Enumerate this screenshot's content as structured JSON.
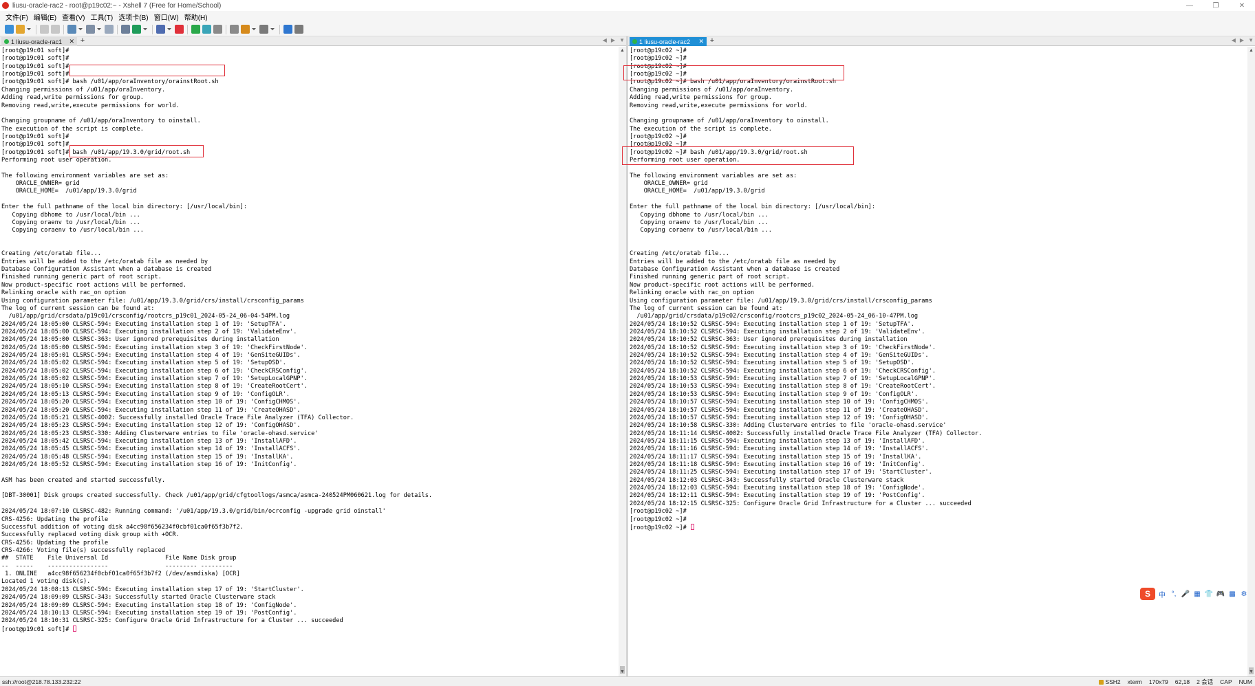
{
  "window": {
    "title": "liusu-oracle-rac2 - root@p19c02:~ - Xshell 7 (Free for Home/School)",
    "controls": [
      "—",
      "❐",
      "✕"
    ]
  },
  "menu": [
    "文件(F)",
    "编辑(E)",
    "查看(V)",
    "工具(T)",
    "选项卡(B)",
    "窗口(W)",
    "帮助(H)"
  ],
  "toolbar": {
    "buttons": [
      {
        "icon": "new-session-icon",
        "color": "#3b8fd8"
      },
      {
        "icon": "open-folder-icon",
        "color": "#e3a630"
      },
      {
        "icon": "reconnect-icon",
        "color": "#c7c7c7"
      },
      {
        "icon": "disconnect-icon",
        "color": "#c7c7c7"
      },
      {
        "icon": "properties-icon",
        "color": "#5a8ab8"
      },
      {
        "icon": "copy-icon",
        "color": "#7f8fa5"
      },
      {
        "icon": "paste-icon",
        "color": "#9aa9bd"
      },
      {
        "icon": "find-icon",
        "color": "#6c7f99"
      },
      {
        "icon": "globe-icon",
        "color": "#1f9c5a"
      },
      {
        "icon": "font-icon",
        "color": "#4f6cb0"
      },
      {
        "icon": "xftp-icon",
        "color": "#e0303a"
      },
      {
        "icon": "xmanager-icon",
        "color": "#2aa84a"
      },
      {
        "icon": "fullscreen-icon",
        "color": "#3aa5b8"
      },
      {
        "icon": "lock-icon",
        "color": "#8a8a8a"
      },
      {
        "icon": "keyboard-icon",
        "color": "#8a8a8a"
      },
      {
        "icon": "script-icon",
        "color": "#d68a1c"
      },
      {
        "icon": "layout-icon",
        "color": "#7a7a7a"
      },
      {
        "icon": "help-icon",
        "color": "#2f77d0"
      },
      {
        "icon": "chat-icon",
        "color": "#7a7a7a"
      }
    ]
  },
  "left_pane": {
    "tab_label": "1 liusu-oracle-rac1",
    "lines": [
      "[root@p19c01 soft]#",
      "[root@p19c01 soft]#",
      "[root@p19c01 soft]#",
      "[root@p19c01 soft]#",
      "[root@p19c01 soft]# bash /u01/app/oraInventory/orainstRoot.sh",
      "Changing permissions of /u01/app/oraInventory.",
      "Adding read,write permissions for group.",
      "Removing read,write,execute permissions for world.",
      "",
      "Changing groupname of /u01/app/oraInventory to oinstall.",
      "The execution of the script is complete.",
      "[root@p19c01 soft]#",
      "[root@p19c01 soft]#",
      "[root@p19c01 soft]# bash /u01/app/19.3.0/grid/root.sh",
      "Performing root user operation.",
      "",
      "The following environment variables are set as:",
      "    ORACLE_OWNER= grid",
      "    ORACLE_HOME=  /u01/app/19.3.0/grid",
      "",
      "Enter the full pathname of the local bin directory: [/usr/local/bin]:",
      "   Copying dbhome to /usr/local/bin ...",
      "   Copying oraenv to /usr/local/bin ...",
      "   Copying coraenv to /usr/local/bin ...",
      "",
      "",
      "Creating /etc/oratab file...",
      "Entries will be added to the /etc/oratab file as needed by",
      "Database Configuration Assistant when a database is created",
      "Finished running generic part of root script.",
      "Now product-specific root actions will be performed.",
      "Relinking oracle with rac_on option",
      "Using configuration parameter file: /u01/app/19.3.0/grid/crs/install/crsconfig_params",
      "The log of current session can be found at:",
      "  /u01/app/grid/crsdata/p19c01/crsconfig/rootcrs_p19c01_2024-05-24_06-04-54PM.log",
      "2024/05/24 18:05:00 CLSRSC-594: Executing installation step 1 of 19: 'SetupTFA'.",
      "2024/05/24 18:05:00 CLSRSC-594: Executing installation step 2 of 19: 'ValidateEnv'.",
      "2024/05/24 18:05:00 CLSRSC-363: User ignored prerequisites during installation",
      "2024/05/24 18:05:00 CLSRSC-594: Executing installation step 3 of 19: 'CheckFirstNode'.",
      "2024/05/24 18:05:01 CLSRSC-594: Executing installation step 4 of 19: 'GenSiteGUIDs'.",
      "2024/05/24 18:05:02 CLSRSC-594: Executing installation step 5 of 19: 'SetupOSD'.",
      "2024/05/24 18:05:02 CLSRSC-594: Executing installation step 6 of 19: 'CheckCRSConfig'.",
      "2024/05/24 18:05:02 CLSRSC-594: Executing installation step 7 of 19: 'SetupLocalGPNP'.",
      "2024/05/24 18:05:10 CLSRSC-594: Executing installation step 8 of 19: 'CreateRootCert'.",
      "2024/05/24 18:05:13 CLSRSC-594: Executing installation step 9 of 19: 'ConfigOLR'.",
      "2024/05/24 18:05:20 CLSRSC-594: Executing installation step 10 of 19: 'ConfigCHMOS'.",
      "2024/05/24 18:05:20 CLSRSC-594: Executing installation step 11 of 19: 'CreateOHASD'.",
      "2024/05/24 18:05:21 CLSRSC-4002: Successfully installed Oracle Trace File Analyzer (TFA) Collector.",
      "2024/05/24 18:05:23 CLSRSC-594: Executing installation step 12 of 19: 'ConfigOHASD'.",
      "2024/05/24 18:05:23 CLSRSC-330: Adding Clusterware entries to file 'oracle-ohasd.service'",
      "2024/05/24 18:05:42 CLSRSC-594: Executing installation step 13 of 19: 'InstallAFD'.",
      "2024/05/24 18:05:45 CLSRSC-594: Executing installation step 14 of 19: 'InstallACFS'.",
      "2024/05/24 18:05:48 CLSRSC-594: Executing installation step 15 of 19: 'InstallKA'.",
      "2024/05/24 18:05:52 CLSRSC-594: Executing installation step 16 of 19: 'InitConfig'.",
      "",
      "ASM has been created and started successfully.",
      "",
      "[DBT-30001] Disk groups created successfully. Check /u01/app/grid/cfgtoollogs/asmca/asmca-240524PM060621.log for details.",
      "",
      "2024/05/24 18:07:10 CLSRSC-482: Running command: '/u01/app/19.3.0/grid/bin/ocrconfig -upgrade grid oinstall'",
      "CRS-4256: Updating the profile",
      "Successful addition of voting disk a4cc98f656234f0cbf01ca0f65f3b7f2.",
      "Successfully replaced voting disk group with +OCR.",
      "CRS-4256: Updating the profile",
      "CRS-4266: Voting file(s) successfully replaced",
      "##  STATE    File Universal Id                File Name Disk group",
      "--  -----    -----------------                --------- ---------",
      " 1. ONLINE   a4cc98f656234f0cbf01ca0f65f3b7f2 (/dev/asmdiska) [OCR]",
      "Located 1 voting disk(s).",
      "2024/05/24 18:08:13 CLSRSC-594: Executing installation step 17 of 19: 'StartCluster'.",
      "2024/05/24 18:09:09 CLSRSC-343: Successfully started Oracle Clusterware stack",
      "2024/05/24 18:09:09 CLSRSC-594: Executing installation step 18 of 19: 'ConfigNode'.",
      "2024/05/24 18:10:13 CLSRSC-594: Executing installation step 19 of 19: 'PostConfig'.",
      "2024/05/24 18:10:31 CLSRSC-325: Configure Oracle Grid Infrastructure for a Cluster ... succeeded",
      "[root@p19c01 soft]# "
    ]
  },
  "right_pane": {
    "tab_label": "1 liusu-oracle-rac2",
    "lines": [
      "[root@p19c02 ~]#",
      "[root@p19c02 ~]#",
      "[root@p19c02 ~]#",
      "[root@p19c02 ~]#",
      "[root@p19c02 ~]# bash /u01/app/oraInventory/orainstRoot.sh",
      "Changing permissions of /u01/app/oraInventory.",
      "Adding read,write permissions for group.",
      "Removing read,write,execute permissions for world.",
      "",
      "Changing groupname of /u01/app/oraInventory to oinstall.",
      "The execution of the script is complete.",
      "[root@p19c02 ~]#",
      "[root@p19c02 ~]#",
      "[root@p19c02 ~]# bash /u01/app/19.3.0/grid/root.sh",
      "Performing root user operation.",
      "",
      "The following environment variables are set as:",
      "    ORACLE_OWNER= grid",
      "    ORACLE_HOME=  /u01/app/19.3.0/grid",
      "",
      "Enter the full pathname of the local bin directory: [/usr/local/bin]:",
      "   Copying dbhome to /usr/local/bin ...",
      "   Copying oraenv to /usr/local/bin ...",
      "   Copying coraenv to /usr/local/bin ...",
      "",
      "",
      "Creating /etc/oratab file...",
      "Entries will be added to the /etc/oratab file as needed by",
      "Database Configuration Assistant when a database is created",
      "Finished running generic part of root script.",
      "Now product-specific root actions will be performed.",
      "Relinking oracle with rac_on option",
      "Using configuration parameter file: /u01/app/19.3.0/grid/crs/install/crsconfig_params",
      "The log of current session can be found at:",
      "  /u01/app/grid/crsdata/p19c02/crsconfig/rootcrs_p19c02_2024-05-24_06-10-47PM.log",
      "2024/05/24 18:10:52 CLSRSC-594: Executing installation step 1 of 19: 'SetupTFA'.",
      "2024/05/24 18:10:52 CLSRSC-594: Executing installation step 2 of 19: 'ValidateEnv'.",
      "2024/05/24 18:10:52 CLSRSC-363: User ignored prerequisites during installation",
      "2024/05/24 18:10:52 CLSRSC-594: Executing installation step 3 of 19: 'CheckFirstNode'.",
      "2024/05/24 18:10:52 CLSRSC-594: Executing installation step 4 of 19: 'GenSiteGUIDs'.",
      "2024/05/24 18:10:52 CLSRSC-594: Executing installation step 5 of 19: 'SetupOSD'.",
      "2024/05/24 18:10:52 CLSRSC-594: Executing installation step 6 of 19: 'CheckCRSConfig'.",
      "2024/05/24 18:10:53 CLSRSC-594: Executing installation step 7 of 19: 'SetupLocalGPNP'.",
      "2024/05/24 18:10:53 CLSRSC-594: Executing installation step 8 of 19: 'CreateRootCert'.",
      "2024/05/24 18:10:53 CLSRSC-594: Executing installation step 9 of 19: 'ConfigOLR'.",
      "2024/05/24 18:10:57 CLSRSC-594: Executing installation step 10 of 19: 'ConfigCHMOS'.",
      "2024/05/24 18:10:57 CLSRSC-594: Executing installation step 11 of 19: 'CreateOHASD'.",
      "2024/05/24 18:10:57 CLSRSC-594: Executing installation step 12 of 19: 'ConfigOHASD'.",
      "2024/05/24 18:10:58 CLSRSC-330: Adding Clusterware entries to file 'oracle-ohasd.service'",
      "2024/05/24 18:11:14 CLSRSC-4002: Successfully installed Oracle Trace File Analyzer (TFA) Collector.",
      "2024/05/24 18:11:15 CLSRSC-594: Executing installation step 13 of 19: 'InstallAFD'.",
      "2024/05/24 18:11:16 CLSRSC-594: Executing installation step 14 of 19: 'InstallACFS'.",
      "2024/05/24 18:11:17 CLSRSC-594: Executing installation step 15 of 19: 'InstallKA'.",
      "2024/05/24 18:11:18 CLSRSC-594: Executing installation step 16 of 19: 'InitConfig'.",
      "2024/05/24 18:11:25 CLSRSC-594: Executing installation step 17 of 19: 'StartCluster'.",
      "2024/05/24 18:12:03 CLSRSC-343: Successfully started Oracle Clusterware stack",
      "2024/05/24 18:12:03 CLSRSC-594: Executing installation step 18 of 19: 'ConfigNode'.",
      "2024/05/24 18:12:11 CLSRSC-594: Executing installation step 19 of 19: 'PostConfig'.",
      "2024/05/24 18:12:15 CLSRSC-325: Configure Oracle Grid Infrastructure for a Cluster ... succeeded",
      "[root@p19c02 ~]#",
      "[root@p19c02 ~]#",
      "[root@p19c02 ~]# "
    ]
  },
  "ime": {
    "logo": "S",
    "buttons": [
      "中",
      "°,",
      "🎤",
      "▦",
      "👕",
      "🎮",
      "▩",
      "⚙"
    ]
  },
  "statusbar": {
    "connection": "ssh://root@218.78.133.232:22",
    "protocol": "SSH2",
    "terminal": "xterm",
    "size": "170x79",
    "position": "62,18",
    "sessions": "2 会话",
    "caps": "CAP",
    "num": "NUM"
  },
  "colors": {
    "highlight_box": "#e0303a",
    "active_tab": "#1f8fd6",
    "cursor": "#e0307a"
  }
}
